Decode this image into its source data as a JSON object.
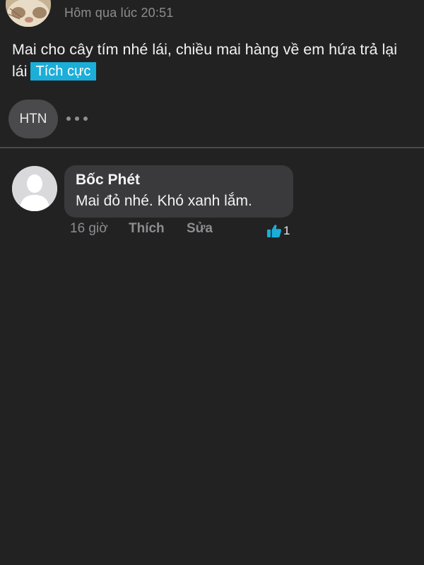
{
  "post": {
    "timestamp": "Hôm qua lúc 20:51",
    "body_text": "Mai cho cây tím nhé lái, chiều mai hàng về em hứa trả lại lái",
    "sentiment_tag": "Tích cực",
    "reactor_initials": "HTN"
  },
  "comment": {
    "author": "Bốc Phét",
    "text": "Mai đỏ nhé. Khó xanh lắm.",
    "time": "16 giờ",
    "like_label": "Thích",
    "edit_label": "Sửa",
    "like_count": "1"
  },
  "icons": {
    "more": "more-horizontal-icon",
    "like": "thumbs-up-icon",
    "default_avatar": "person-silhouette-icon"
  },
  "colors": {
    "background": "#222223",
    "accent": "#1aaed8",
    "bubble": "#3a3a3c"
  }
}
